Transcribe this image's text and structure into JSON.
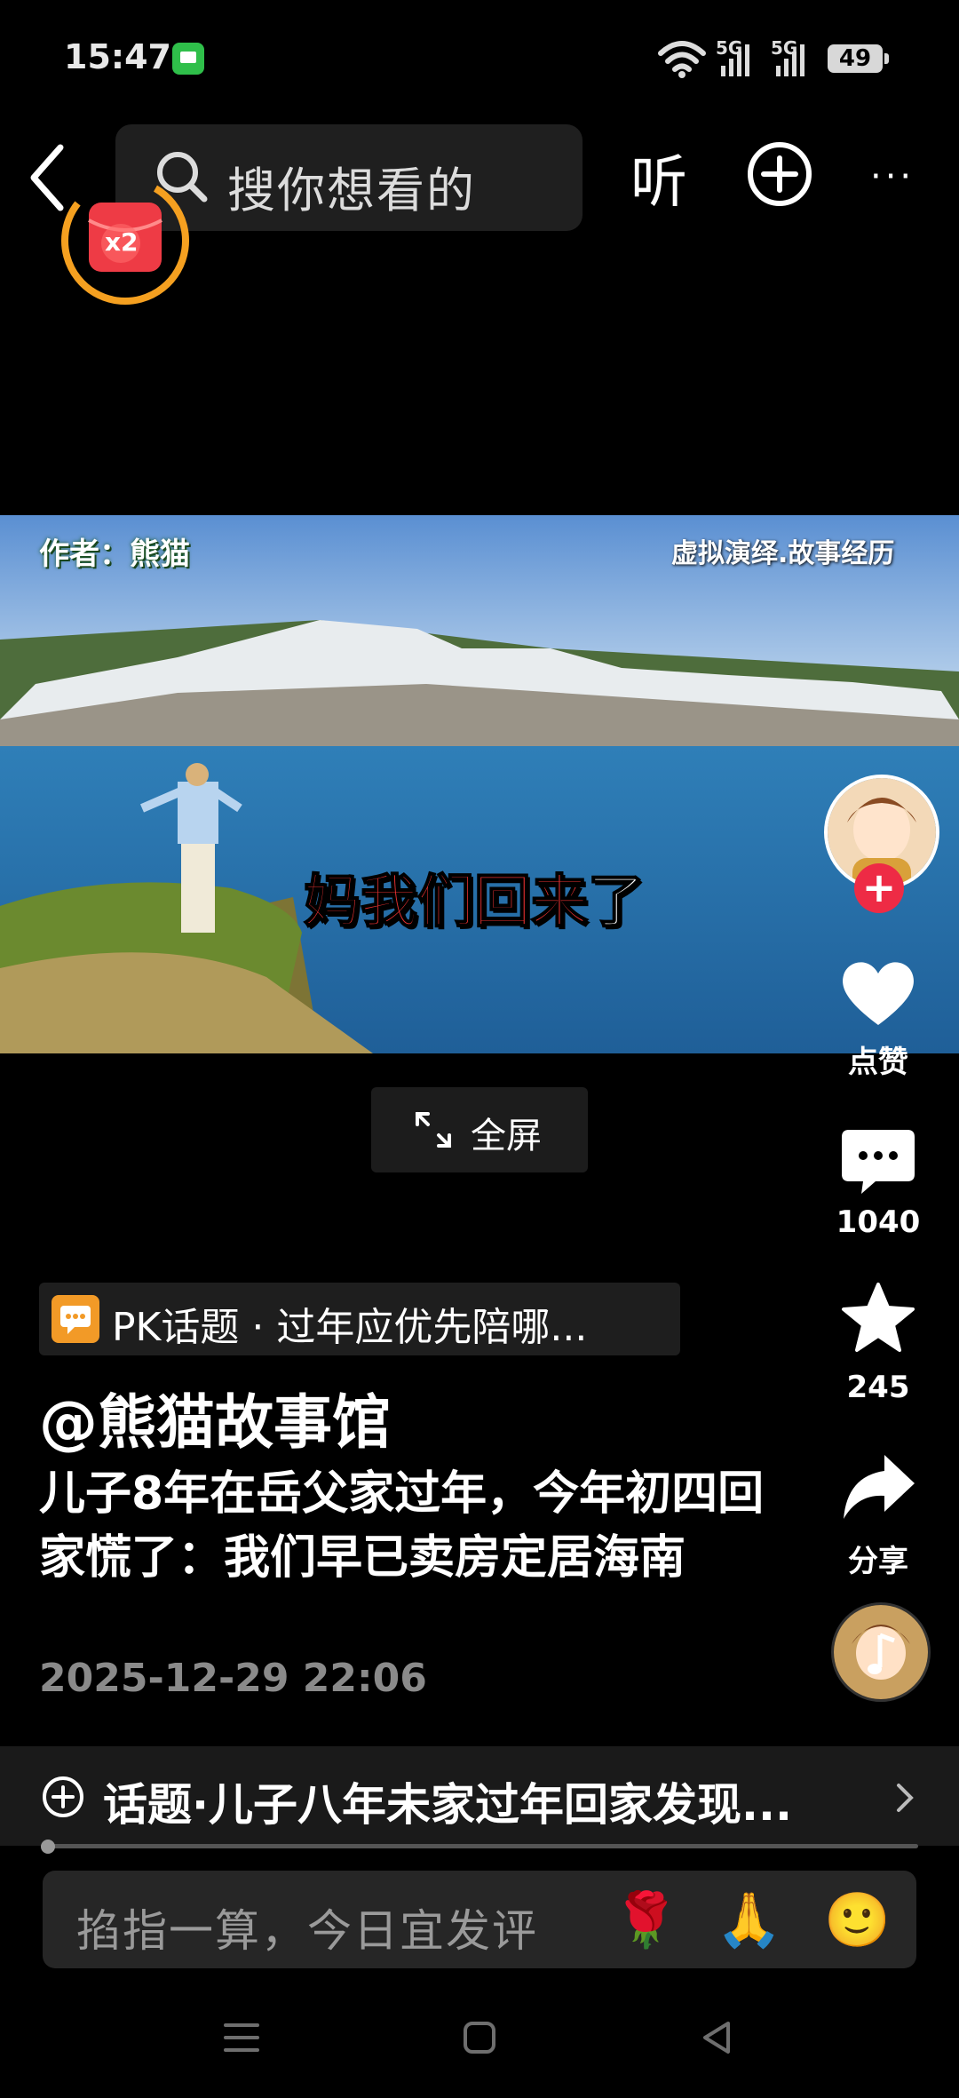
{
  "status_bar": {
    "time": "15:47",
    "network1": "5G",
    "network2": "5G",
    "battery": "49"
  },
  "top_nav": {
    "search_placeholder": "搜你想看的",
    "listen_label": "听",
    "more_label": "···",
    "red_packet_badge": "x2"
  },
  "video": {
    "author_tag": "作者：熊猫",
    "disclaimer": "虚拟演绎.故事经历",
    "subtitle_main": "妈我们回来",
    "subtitle_end": "了"
  },
  "actions": {
    "like_label": "点赞",
    "comment_count": "1040",
    "favorite_count": "245",
    "share_label": "分享",
    "follow_icon": "+"
  },
  "fullscreen_label": "全屏",
  "post": {
    "pk_topic": "PK话题 · 过年应优先陪哪...",
    "handle": "@熊猫故事馆",
    "description": "儿子8年在岳父家过年，今年初四回家慌了：我们早已卖房定居海南",
    "date": "2025-12-29 22:06"
  },
  "topic_bar": {
    "text": "话题·儿子八年未家过年回家发现..."
  },
  "progress": {
    "value": 0.01
  },
  "comment": {
    "placeholder": "掐指一算，今日宜发评",
    "emojis": [
      "🌹",
      "🙏",
      "🙂"
    ]
  },
  "colors": {
    "accent_red": "#ee2b45",
    "ring_orange": "#f5a020",
    "pk_orange": "#f29a27"
  }
}
